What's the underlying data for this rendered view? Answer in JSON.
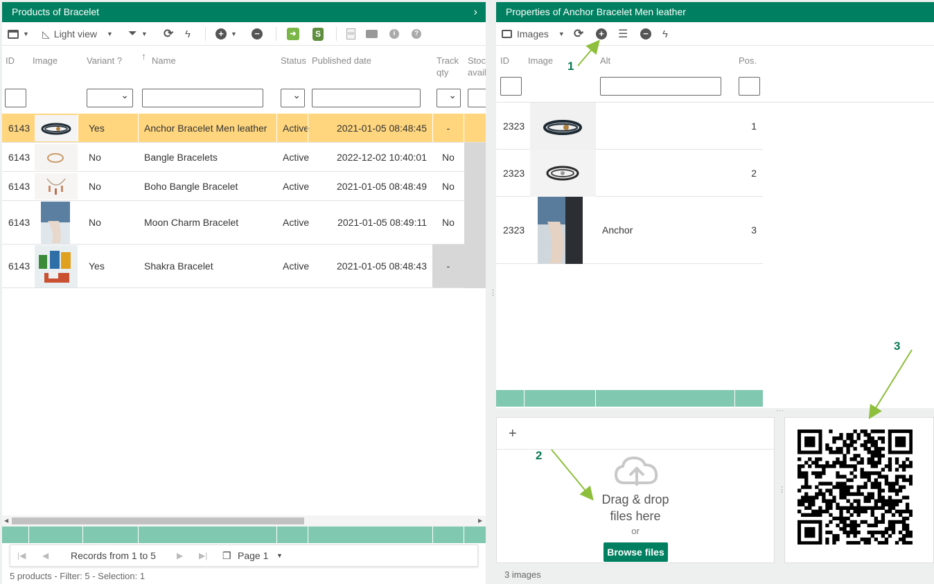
{
  "left_panel": {
    "title": "Products of Bracelet",
    "toolbar": {
      "light_view": "Light view"
    },
    "columns": [
      "ID",
      "Image",
      "Variant ?",
      "Name",
      "Status",
      "Published date",
      "Track qty",
      "Stock avail"
    ],
    "rows": [
      {
        "id": "6143",
        "variant": "Yes",
        "name": "Anchor Bracelet Men leather",
        "status": "Active",
        "published": "2021-01-05 08:48:45",
        "track": "-"
      },
      {
        "id": "6143",
        "variant": "No",
        "name": "Bangle Bracelets",
        "status": "Active",
        "published": "2022-12-02 10:40:01",
        "track": "No"
      },
      {
        "id": "6143",
        "variant": "No",
        "name": "Boho Bangle Bracelet",
        "status": "Active",
        "published": "2021-01-05 08:48:49",
        "track": "No"
      },
      {
        "id": "6143",
        "variant": "No",
        "name": "Moon Charm Bracelet",
        "status": "Active",
        "published": "2021-01-05 08:49:11",
        "track": "No"
      },
      {
        "id": "6143",
        "variant": "Yes",
        "name": "Shakra Bracelet",
        "status": "Active",
        "published": "2021-01-05 08:48:43",
        "track": "-"
      }
    ],
    "pager": {
      "records": "Records from 1 to 5",
      "page": "Page 1"
    },
    "status": "5 products - Filter: 5 - Selection: 1"
  },
  "right_panel": {
    "title": "Properties of Anchor Bracelet Men leather",
    "toolbar": {
      "images": "Images"
    },
    "columns": [
      "ID",
      "Image",
      "Alt",
      "Pos."
    ],
    "rows": [
      {
        "id": "2323",
        "alt": "",
        "pos": "1"
      },
      {
        "id": "2323",
        "alt": "",
        "pos": "2"
      },
      {
        "id": "2323",
        "alt": "Anchor",
        "pos": "3"
      }
    ],
    "upload": {
      "plus": "+",
      "drag": "Drag & drop",
      "files": "files here",
      "or": "or",
      "browse": "Browse files"
    },
    "status": "3 images"
  },
  "annotations": [
    "1",
    "2",
    "3"
  ],
  "colors": {
    "header": "#008060",
    "selected_row": "#ffd67e",
    "footer_strip": "#80c8b0",
    "annotation": "#0b7a55",
    "arrow": "#8dbf3c"
  }
}
